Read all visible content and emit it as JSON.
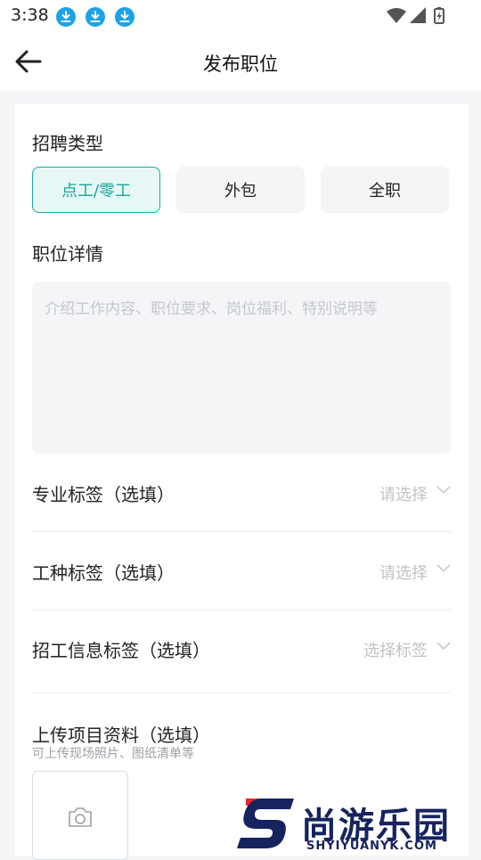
{
  "status_bar": {
    "time": "3:38",
    "notifications": [
      "download-icon",
      "download-icon",
      "download-icon"
    ],
    "system_icons": [
      "wifi-icon",
      "signal-icon",
      "battery-icon"
    ]
  },
  "header": {
    "title": "发布职位",
    "back_icon": "arrow-left-icon"
  },
  "recruit_type": {
    "title": "招聘类型",
    "options": [
      {
        "label": "点工/零工",
        "selected": true
      },
      {
        "label": "外包",
        "selected": false
      },
      {
        "label": "全职",
        "selected": false
      }
    ]
  },
  "job_detail": {
    "title": "职位详情",
    "value": "",
    "placeholder": "介绍工作内容、职位要求、岗位福利、特别说明等"
  },
  "tags": [
    {
      "label": "专业标签（选填）",
      "value": "请选择"
    },
    {
      "label": "工种标签（选填）",
      "value": "请选择"
    },
    {
      "label": "招工信息标签（选填）",
      "value": "选择标签"
    }
  ],
  "upload": {
    "title": "上传项目资料（选填）",
    "hint": "可上传现场照片、图纸清单等",
    "icon": "camera-icon"
  },
  "watermark": {
    "logo_text": "尚游乐园",
    "url": "SHYIYUANYK.COM"
  },
  "colors": {
    "accent": "#19aa9b",
    "accent_bg": "#e6f7f5",
    "field_bg": "#f4f5f7",
    "placeholder": "#c5c8cd",
    "download_badge": "#1aa3e8",
    "watermark_navy": "#16235e",
    "watermark_red": "#e8262c"
  }
}
